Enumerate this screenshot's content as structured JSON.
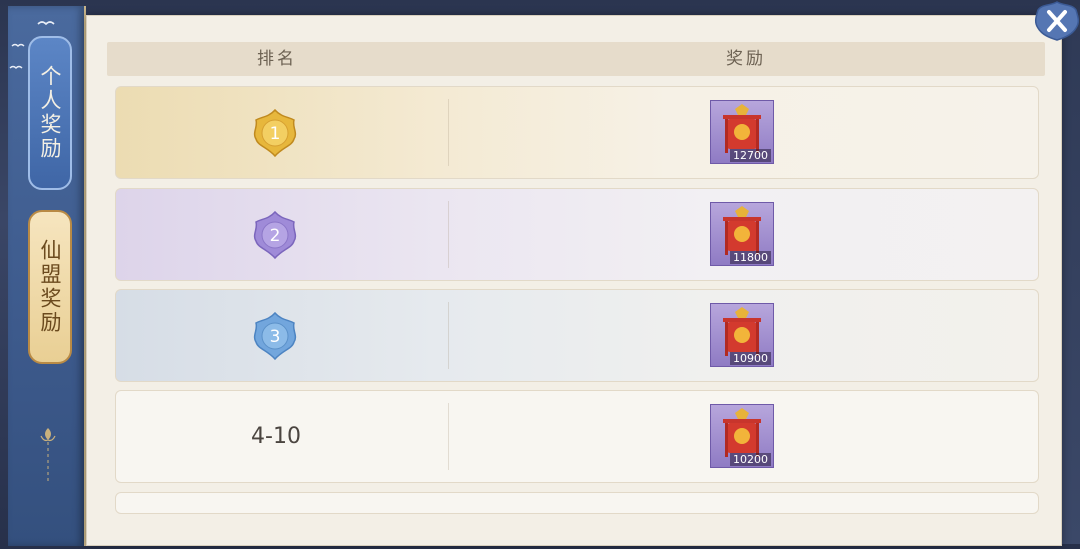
{
  "tabs": {
    "personal": "个人奖励",
    "guild": "仙盟奖励",
    "active": "personal"
  },
  "table": {
    "headers": {
      "rank": "排名",
      "reward": "奖励"
    },
    "rows": [
      {
        "rank": "1",
        "badge_color": "#e6b53a",
        "reward_icon": "red-banner-icon",
        "reward_qty": "12700"
      },
      {
        "rank": "2",
        "badge_color": "#9a86d6",
        "reward_icon": "red-banner-icon",
        "reward_qty": "11800"
      },
      {
        "rank": "3",
        "badge_color": "#6ea3dc",
        "reward_icon": "red-banner-icon",
        "reward_qty": "10900"
      },
      {
        "rank": "4-10",
        "badge_color": null,
        "reward_icon": "red-banner-icon",
        "reward_qty": "10200"
      }
    ]
  },
  "colors": {
    "tab_active": "#4f79ba",
    "tab_inactive": "#f0dcaa",
    "panel_bg": "#f3efe6",
    "header_bg": "#e6dccb"
  },
  "close_icon": "close-icon"
}
